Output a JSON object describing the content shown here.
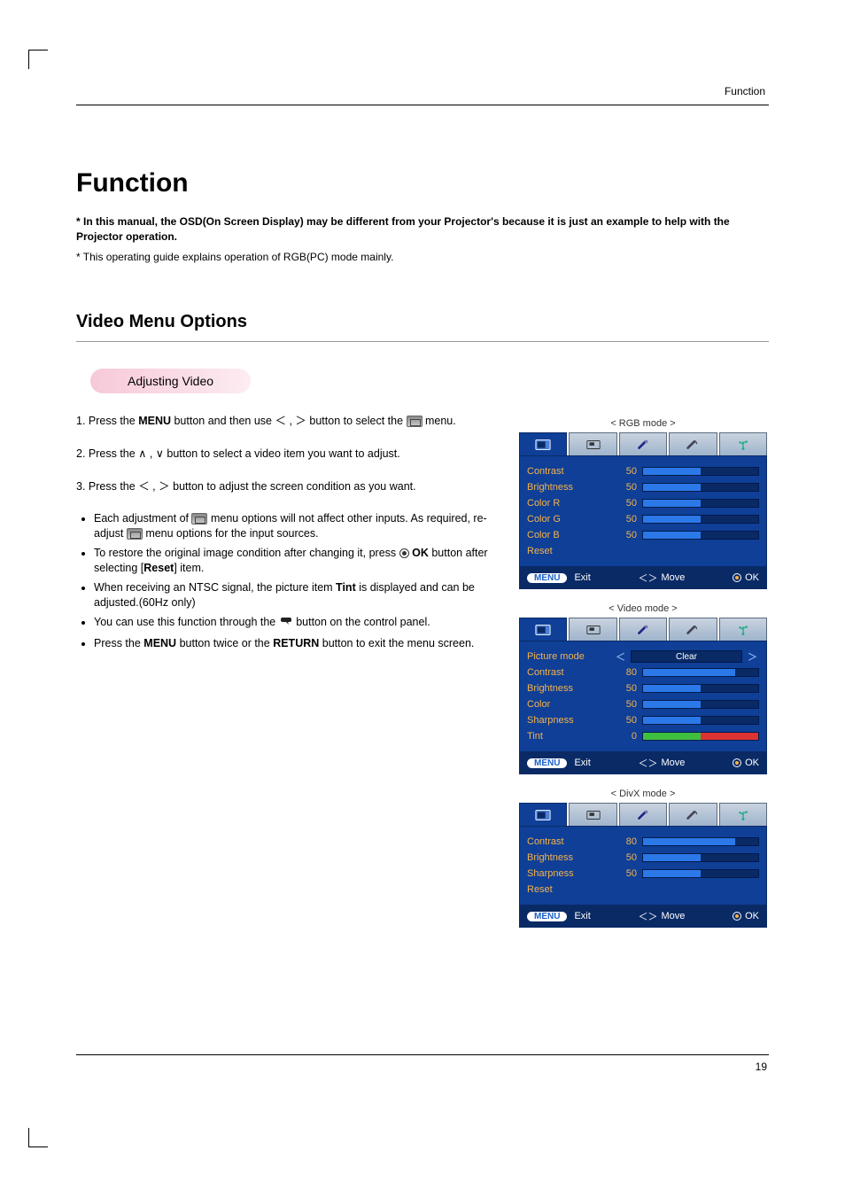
{
  "header": {
    "section_label": "Function",
    "page": "19"
  },
  "titles": {
    "h1": "Function",
    "note_bold": "* In this manual, the OSD(On Screen Display) may be different from your Projector's because it is just an example to help with the Projector operation.",
    "note_plain": "* This operating guide explains operation of RGB(PC) mode mainly.",
    "h2": "Video Menu Options",
    "pill": "Adjusting Video"
  },
  "steps": {
    "s1_a": "1. Press the ",
    "s1_menu": "MENU",
    "s1_b": " button and then use ",
    "s1_lt": "＜",
    "s1_comma": " , ",
    "s1_gt": "＞",
    "s1_c": " button to select the ",
    "s1_d": " menu.",
    "s2_a": "2. Press the ",
    "s2_up": "∧",
    "s2_comma": " , ",
    "s2_dn": "∨",
    "s2_b": " button to select a video item you want to adjust.",
    "s3_a": "3. Press the ",
    "s3_lt": "＜",
    "s3_comma": " , ",
    "s3_gt": "＞",
    "s3_b": " button to adjust the screen condition as you want."
  },
  "bullets": {
    "b1a": "Each adjustment of ",
    "b1b": " menu options will not affect other inputs. As required, re-adjust ",
    "b1c": " menu options for the input sources.",
    "b2a": "To restore the original image condition after changing it, press ",
    "b2_ok": "OK",
    "b2b": " button after selecting [",
    "b2_reset": "Reset",
    "b2c": "] item.",
    "b3a": "When receiving an NTSC signal, the picture item ",
    "b3_tint": "Tint",
    "b3b": " is displayed and can be adjusted.(60Hz only)",
    "b4a": "You can use this function through the ",
    "b4b": " button on the control panel.",
    "b5a": "Press the ",
    "b5_menu": "MENU",
    "b5b": " button twice or the ",
    "b5_return": "RETURN",
    "b5c": " button to exit the menu screen."
  },
  "osd_common": {
    "footer_menu": "MENU",
    "footer_exit": "Exit",
    "footer_move_sym": "＜＞",
    "footer_move": "Move",
    "footer_ok": "OK"
  },
  "osd_rgb": {
    "label": "< RGB mode >",
    "rows": [
      {
        "name": "Contrast",
        "value": "50",
        "fill": 50
      },
      {
        "name": "Brightness",
        "value": "50",
        "fill": 50
      },
      {
        "name": "Color  R",
        "value": "50",
        "fill": 50
      },
      {
        "name": "Color  G",
        "value": "50",
        "fill": 50
      },
      {
        "name": "Color  B",
        "value": "50",
        "fill": 50
      }
    ],
    "reset": "Reset"
  },
  "osd_video": {
    "label": "< Video mode >",
    "picture_mode_label": "Picture mode",
    "picture_mode_value": "Clear",
    "rows": [
      {
        "name": "Contrast",
        "value": "80",
        "fill": 80
      },
      {
        "name": "Brightness",
        "value": "50",
        "fill": 50
      },
      {
        "name": "Color",
        "value": "50",
        "fill": 50
      },
      {
        "name": "Sharpness",
        "value": "50",
        "fill": 50
      }
    ],
    "tint_label": "Tint",
    "tint_value": "0"
  },
  "osd_divx": {
    "label": "< DivX mode >",
    "rows": [
      {
        "name": "Contrast",
        "value": "80",
        "fill": 80
      },
      {
        "name": "Brightness",
        "value": "50",
        "fill": 50
      },
      {
        "name": "Sharpness",
        "value": "50",
        "fill": 50
      }
    ],
    "reset": "Reset"
  }
}
